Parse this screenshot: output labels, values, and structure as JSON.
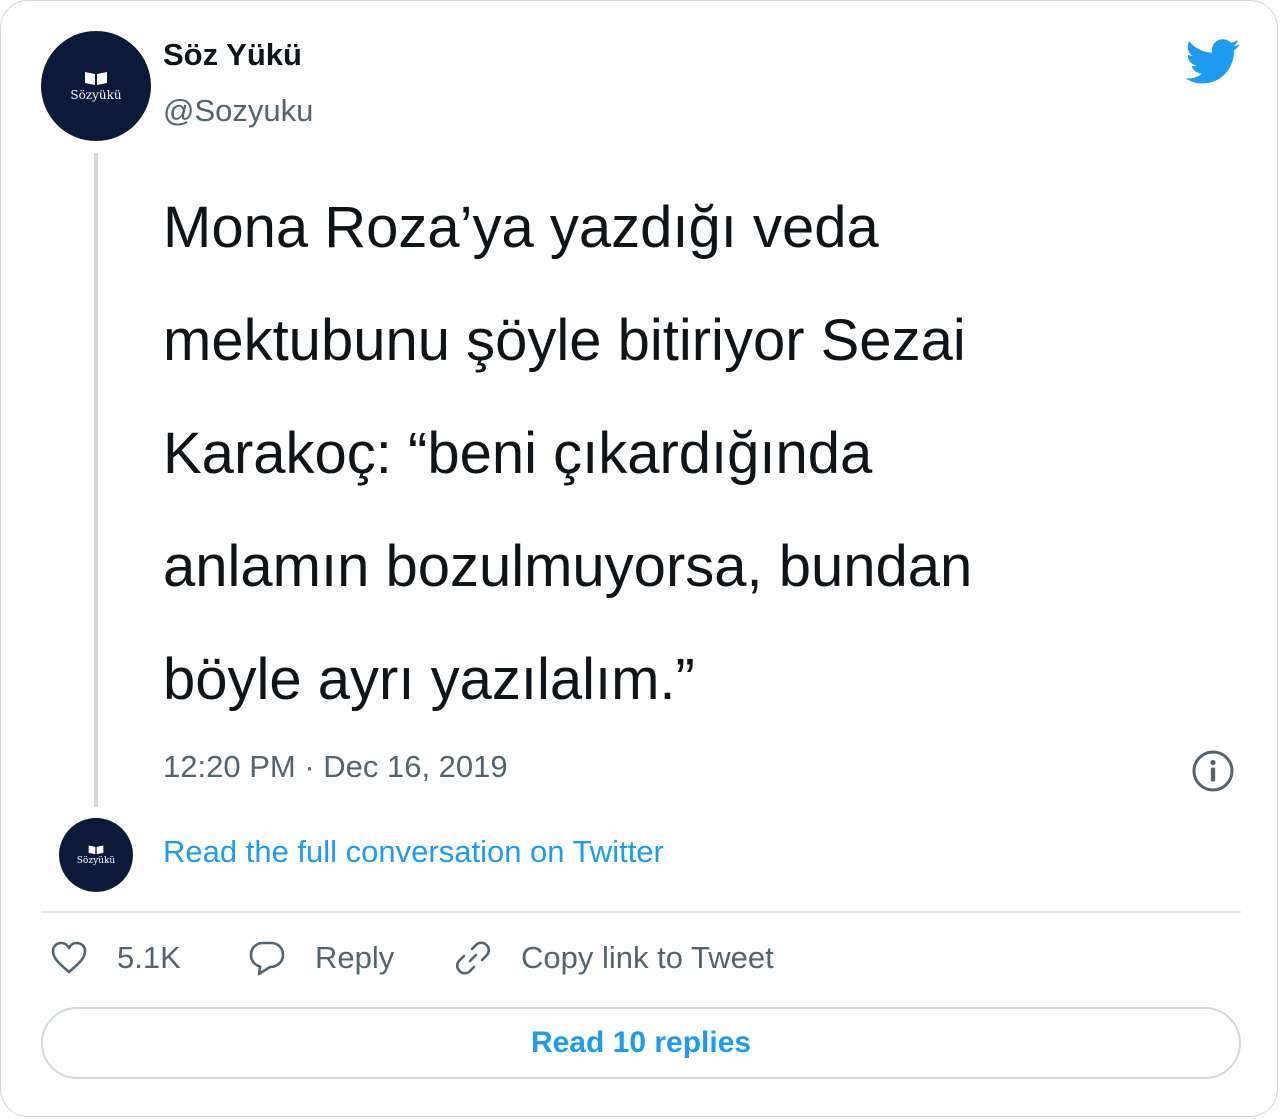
{
  "author": {
    "name": "Söz Yükü",
    "handle": "@Sozyuku",
    "avatar_text": "Sözyükü"
  },
  "tweet": {
    "lines": [
      "Mona Roza’ya yazdığı veda",
      "mektubunu şöyle bitiriyor Sezai",
      "Karakoç: “beni çıkardığında",
      "anlamın bozulmuyorsa, bundan",
      "böyle ayrı yazılalım.”"
    ],
    "timestamp": "12:20 PM · Dec 16, 2019"
  },
  "conversation": {
    "link_label": "Read the full conversation on Twitter"
  },
  "actions": {
    "like_count": "5.1K",
    "reply_label": "Reply",
    "copy_link_label": "Copy link to Tweet"
  },
  "replies_button": {
    "label": "Read 10 replies"
  },
  "icons": {
    "brand": "twitter-bird-icon",
    "info": "info-icon",
    "like": "heart-icon",
    "reply": "speech-bubble-icon",
    "copy": "link-icon",
    "avatar_glyph": "book-icon"
  },
  "colors": {
    "accent": "#1d9bf0",
    "text": "#0f1419",
    "muted": "#536471",
    "border": "#cfd9de",
    "avatar_bg": "#0b1a3a"
  }
}
